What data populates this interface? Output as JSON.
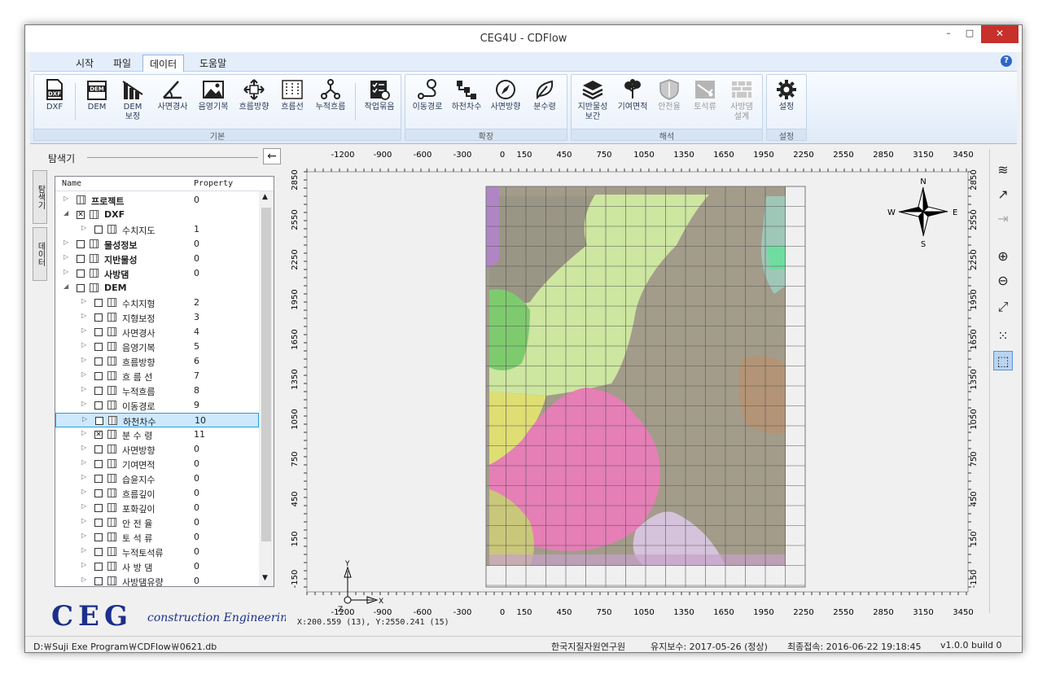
{
  "window": {
    "title": "CEG4U - CDFlow",
    "min": "–",
    "max": "□",
    "close": "✕"
  },
  "menu": {
    "items": [
      "시작",
      "파일",
      "데이터",
      "도움말"
    ],
    "active": 2,
    "help": "?"
  },
  "ribbon": {
    "groups": [
      {
        "label": "기본",
        "buttons": [
          "DXF",
          "DEM",
          "DEM\n보정",
          "사면경사",
          "음영기복",
          "흐름방향",
          "흐름선",
          "누적흐름",
          "작업묶음"
        ]
      },
      {
        "label": "확장",
        "buttons": [
          "이동경로",
          "하천차수",
          "사면방향",
          "분수령"
        ]
      },
      {
        "label": "해석",
        "buttons": [
          "지반물성\n보간",
          "기여면적",
          "안전율",
          "토석류",
          "사방댐\n설계"
        ]
      },
      {
        "label": "설정",
        "buttons": [
          "설정"
        ]
      }
    ]
  },
  "explorer": {
    "title": "탐색기",
    "vtabs": [
      "탐색기",
      "데이터"
    ],
    "columns": [
      "Name",
      "Property"
    ],
    "rows": [
      {
        "name": "프로젝트",
        "prop": "0",
        "bold": true,
        "level": 0,
        "checkbox": false
      },
      {
        "name": "DXF",
        "prop": "",
        "bold": true,
        "level": 0,
        "checkbox": true,
        "checked": true,
        "expanded": true
      },
      {
        "name": "수치지도",
        "prop": "1",
        "bold": false,
        "level": 1,
        "checkbox": true
      },
      {
        "name": "물성정보",
        "prop": "0",
        "bold": true,
        "level": 0,
        "checkbox": true
      },
      {
        "name": "지반물성",
        "prop": "0",
        "bold": true,
        "level": 0,
        "checkbox": true
      },
      {
        "name": "사방댐",
        "prop": "0",
        "bold": true,
        "level": 0,
        "checkbox": true
      },
      {
        "name": "DEM",
        "prop": "",
        "bold": true,
        "level": 0,
        "checkbox": true,
        "expanded": true
      },
      {
        "name": "수치지형",
        "prop": "2",
        "level": 1,
        "checkbox": true
      },
      {
        "name": "지형보정",
        "prop": "3",
        "level": 1,
        "checkbox": true
      },
      {
        "name": "사면경사",
        "prop": "4",
        "level": 1,
        "checkbox": true
      },
      {
        "name": "음영기복",
        "prop": "5",
        "level": 1,
        "checkbox": true
      },
      {
        "name": "흐름방향",
        "prop": "6",
        "level": 1,
        "checkbox": true
      },
      {
        "name": "흐 름 선",
        "prop": "7",
        "level": 1,
        "checkbox": true
      },
      {
        "name": "누적흐름",
        "prop": "8",
        "level": 1,
        "checkbox": true
      },
      {
        "name": "이동경로",
        "prop": "9",
        "level": 1,
        "checkbox": true
      },
      {
        "name": "하천차수",
        "prop": "10",
        "level": 1,
        "checkbox": true,
        "selected": true
      },
      {
        "name": "분 수 령",
        "prop": "11",
        "level": 1,
        "checkbox": true,
        "checked": true
      },
      {
        "name": "사면방향",
        "prop": "0",
        "level": 1,
        "checkbox": true
      },
      {
        "name": "기여면적",
        "prop": "0",
        "level": 1,
        "checkbox": true
      },
      {
        "name": "습윤지수",
        "prop": "0",
        "level": 1,
        "checkbox": true
      },
      {
        "name": "흐름깊이",
        "prop": "0",
        "level": 1,
        "checkbox": true
      },
      {
        "name": "포화깊이",
        "prop": "0",
        "level": 1,
        "checkbox": true
      },
      {
        "name": "안 전 율",
        "prop": "0",
        "level": 1,
        "checkbox": true
      },
      {
        "name": "토 석 류",
        "prop": "0",
        "level": 1,
        "checkbox": true
      },
      {
        "name": "누적토석류",
        "prop": "0",
        "level": 1,
        "checkbox": true
      },
      {
        "name": "사 방 댐",
        "prop": "0",
        "level": 1,
        "checkbox": true
      },
      {
        "name": "사방댐유량",
        "prop": "0",
        "level": 1,
        "checkbox": true
      }
    ]
  },
  "logo": {
    "main": "CEG",
    "sub": "construction Engineering Group"
  },
  "map": {
    "x_ticks": [
      "-1200",
      "-900",
      "-600",
      "-300",
      "0",
      "150",
      "450",
      "750",
      "1050",
      "1350",
      "1650",
      "1950",
      "2250",
      "2550",
      "2850",
      "3150",
      "3450"
    ],
    "y_ticks": [
      "2850",
      "2550",
      "2250",
      "1950",
      "1650",
      "1350",
      "1050",
      "750",
      "450",
      "150",
      "-150"
    ],
    "compass": {
      "n": "N",
      "s": "S",
      "e": "E",
      "w": "W"
    },
    "axis": {
      "x": "X",
      "y": "Y",
      "z": "Z"
    },
    "coords": "X:200.559 (13), Y:2550.241 (15)"
  },
  "status": {
    "path": "D:￦Suji Exe Program￦CDFlow￦0621.db",
    "org": "한국지질자원연구원",
    "maint": "유지보수: 2017-05-26 (정상)",
    "last": "최종접속: 2016-06-22 19:18:45",
    "version": "v1.0.0 build 0"
  },
  "colors": {
    "accent": "#2e66c8",
    "close": "#c7302b",
    "selection": "#cde8ff"
  }
}
